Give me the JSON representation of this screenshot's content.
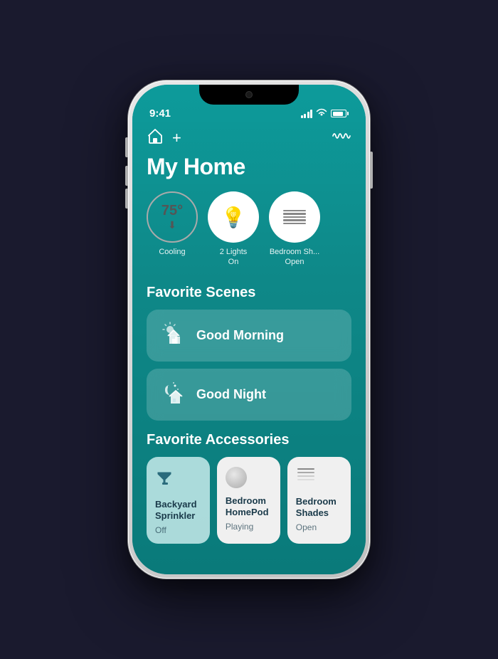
{
  "status_bar": {
    "time": "9:41"
  },
  "header": {
    "title": "My Home"
  },
  "devices": [
    {
      "id": "thermostat",
      "value": "75°",
      "label": "Cooling",
      "type": "temp"
    },
    {
      "id": "lights",
      "value": "💡",
      "label": "2 Lights\nOn",
      "type": "bulb"
    },
    {
      "id": "shades",
      "value": "",
      "label": "Bedroom Sh...\nOpen",
      "type": "blinds"
    }
  ],
  "scenes": {
    "section_title": "Favorite Scenes",
    "items": [
      {
        "id": "good-morning",
        "label": "Good Morning",
        "icon": "morning"
      },
      {
        "id": "good-night",
        "label": "Good Night",
        "icon": "night"
      }
    ]
  },
  "accessories": {
    "section_title": "Favorite Accessories",
    "items": [
      {
        "id": "sprinkler",
        "name": "Backyard\nSprinkler",
        "status": "Off",
        "type": "sprinkler"
      },
      {
        "id": "homepod",
        "name": "Bedroom\nHomePod",
        "status": "Playing",
        "type": "homepod"
      },
      {
        "id": "shades",
        "name": "Bedroom\nShades",
        "status": "Open",
        "type": "blinds"
      }
    ]
  }
}
